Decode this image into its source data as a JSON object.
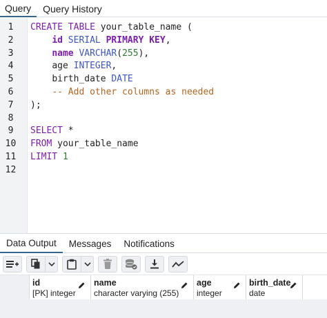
{
  "top_tabs": [
    "Query",
    "Query History"
  ],
  "line_numbers": [
    "1",
    "2",
    "3",
    "4",
    "5",
    "6",
    "7",
    "8",
    "9",
    "10",
    "11",
    "12"
  ],
  "code": {
    "l1_create": "CREATE",
    "l1_table": "TABLE",
    "l1_rest": " your_table_name (",
    "l2_id": "id",
    "l2_serial": "SERIAL",
    "l2_pk": "PRIMARY KEY",
    "l2_comma": ",",
    "l3_name": "name",
    "l3_varchar": "VARCHAR",
    "l3_open": "(",
    "l3_num": "255",
    "l3_close": "),",
    "l4_age": "age",
    "l4_int": "INTEGER",
    "l4_comma": ",",
    "l5_birth": "birth_date",
    "l5_date": "DATE",
    "l6_comment": "-- Add other columns as needed",
    "l7": ");",
    "l9_select": "SELECT",
    "l9_rest": " *",
    "l10_from": "FROM",
    "l10_rest": " your_table_name",
    "l11_limit": "LIMIT",
    "l11_num": "1"
  },
  "bottom_tabs": [
    "Data Output",
    "Messages",
    "Notifications"
  ],
  "toolbar_icons": [
    "add-row-icon",
    "copy-icon",
    "paste-icon",
    "delete-icon",
    "save-data-icon",
    "download-icon",
    "graph-icon"
  ],
  "columns": [
    {
      "name": "id",
      "type": "[PK] integer"
    },
    {
      "name": "name",
      "type": "character varying (255)"
    },
    {
      "name": "age",
      "type": "integer"
    },
    {
      "name": "birth_date",
      "type": "date"
    }
  ]
}
